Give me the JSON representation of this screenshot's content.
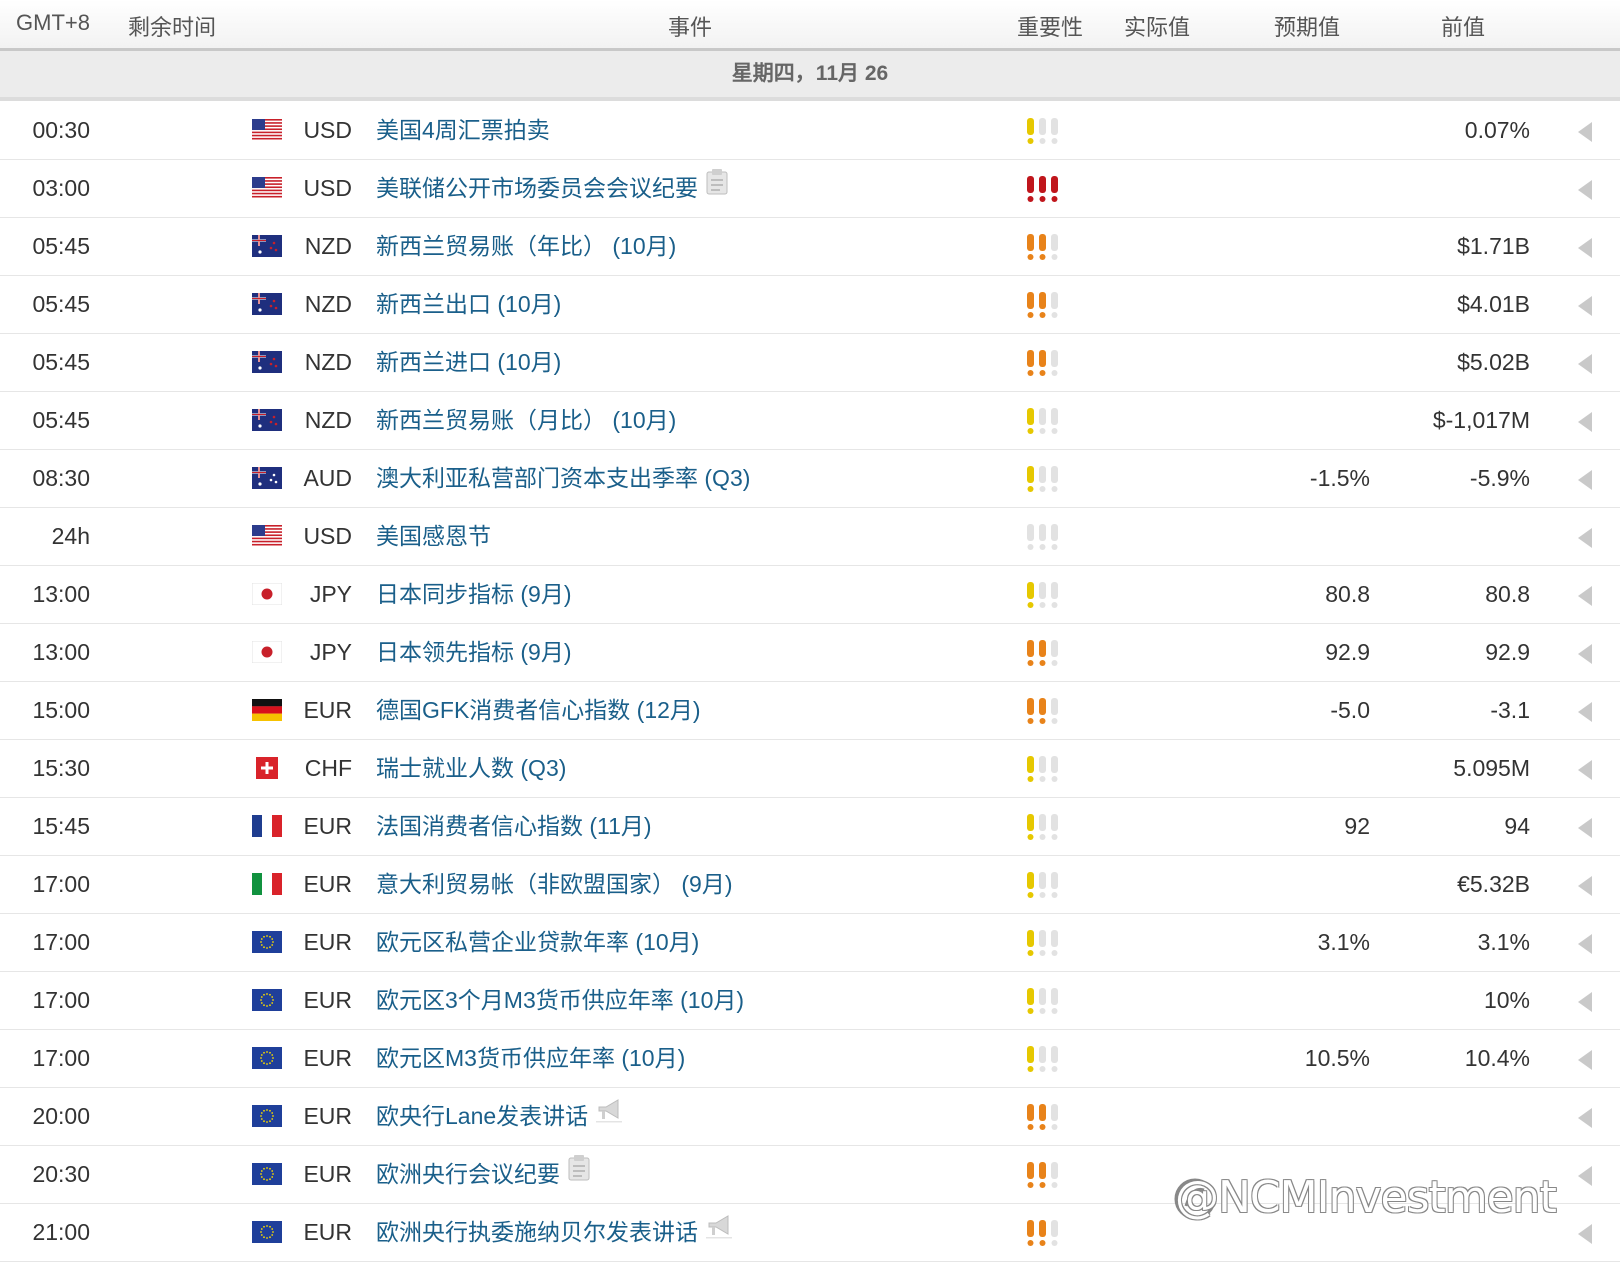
{
  "header": {
    "timezone": "GMT+8",
    "remaining": "剩余时间",
    "event": "事件",
    "importance": "重要性",
    "actual": "实际值",
    "forecast": "预期值",
    "previous": "前值"
  },
  "date_label": "星期四，11月 26",
  "colors": {
    "event_link": "#1a5f8a",
    "importance_low": "#e6c800",
    "importance_medium": "#e8831a",
    "importance_high": "#c0161c",
    "importance_empty": "#e2e2e2"
  },
  "events": [
    {
      "time": "00:30",
      "flag": "us",
      "currency": "USD",
      "name": "美国4周汇票拍卖",
      "icon": "",
      "importance": 1,
      "actual": "",
      "forecast": "",
      "previous": "0.07%"
    },
    {
      "time": "03:00",
      "flag": "us",
      "currency": "USD",
      "name": "美联储公开市场委员会会议纪要",
      "icon": "document-icon",
      "importance": 3,
      "actual": "",
      "forecast": "",
      "previous": ""
    },
    {
      "time": "05:45",
      "flag": "nz",
      "currency": "NZD",
      "name": "新西兰贸易账（年比） (10月)",
      "icon": "",
      "importance": 2,
      "actual": "",
      "forecast": "",
      "previous": "$1.71B"
    },
    {
      "time": "05:45",
      "flag": "nz",
      "currency": "NZD",
      "name": "新西兰出口 (10月)",
      "icon": "",
      "importance": 2,
      "actual": "",
      "forecast": "",
      "previous": "$4.01B"
    },
    {
      "time": "05:45",
      "flag": "nz",
      "currency": "NZD",
      "name": "新西兰进口 (10月)",
      "icon": "",
      "importance": 2,
      "actual": "",
      "forecast": "",
      "previous": "$5.02B"
    },
    {
      "time": "05:45",
      "flag": "nz",
      "currency": "NZD",
      "name": "新西兰贸易账（月比） (10月)",
      "icon": "",
      "importance": 1,
      "actual": "",
      "forecast": "",
      "previous": "$-1,017M"
    },
    {
      "time": "08:30",
      "flag": "au",
      "currency": "AUD",
      "name": "澳大利亚私营部门资本支出季率 (Q3)",
      "icon": "",
      "importance": 1,
      "actual": "",
      "forecast": "-1.5%",
      "previous": "-5.9%"
    },
    {
      "time": "24h",
      "flag": "us",
      "currency": "USD",
      "name": "美国感恩节",
      "icon": "",
      "importance": 0,
      "actual": "",
      "forecast": "",
      "previous": ""
    },
    {
      "time": "13:00",
      "flag": "jp",
      "currency": "JPY",
      "name": "日本同步指标 (9月)",
      "icon": "",
      "importance": 1,
      "actual": "",
      "forecast": "80.8",
      "previous": "80.8"
    },
    {
      "time": "13:00",
      "flag": "jp",
      "currency": "JPY",
      "name": "日本领先指标 (9月)",
      "icon": "",
      "importance": 2,
      "actual": "",
      "forecast": "92.9",
      "previous": "92.9"
    },
    {
      "time": "15:00",
      "flag": "de",
      "currency": "EUR",
      "name": "德国GFK消费者信心指数 (12月)",
      "icon": "",
      "importance": 2,
      "actual": "",
      "forecast": "-5.0",
      "previous": "-3.1"
    },
    {
      "time": "15:30",
      "flag": "ch",
      "currency": "CHF",
      "name": "瑞士就业人数 (Q3)",
      "icon": "",
      "importance": 1,
      "actual": "",
      "forecast": "",
      "previous": "5.095M"
    },
    {
      "time": "15:45",
      "flag": "fr",
      "currency": "EUR",
      "name": "法国消费者信心指数 (11月)",
      "icon": "",
      "importance": 1,
      "actual": "",
      "forecast": "92",
      "previous": "94"
    },
    {
      "time": "17:00",
      "flag": "it",
      "currency": "EUR",
      "name": "意大利贸易帐（非欧盟国家） (9月)",
      "icon": "",
      "importance": 1,
      "actual": "",
      "forecast": "",
      "previous": "€5.32B"
    },
    {
      "time": "17:00",
      "flag": "eu",
      "currency": "EUR",
      "name": "欧元区私营企业贷款年率 (10月)",
      "icon": "",
      "importance": 1,
      "actual": "",
      "forecast": "3.1%",
      "previous": "3.1%"
    },
    {
      "time": "17:00",
      "flag": "eu",
      "currency": "EUR",
      "name": "欧元区3个月M3货币供应年率 (10月)",
      "icon": "",
      "importance": 1,
      "actual": "",
      "forecast": "",
      "previous": "10%"
    },
    {
      "time": "17:00",
      "flag": "eu",
      "currency": "EUR",
      "name": "欧元区M3货币供应年率 (10月)",
      "icon": "",
      "importance": 1,
      "actual": "",
      "forecast": "10.5%",
      "previous": "10.4%"
    },
    {
      "time": "20:00",
      "flag": "eu",
      "currency": "EUR",
      "name": "欧央行Lane发表讲话",
      "icon": "megaphone-icon",
      "importance": 2,
      "actual": "",
      "forecast": "",
      "previous": ""
    },
    {
      "time": "20:30",
      "flag": "eu",
      "currency": "EUR",
      "name": "欧洲央行会议纪要",
      "icon": "document-icon",
      "importance": 2,
      "actual": "",
      "forecast": "",
      "previous": ""
    },
    {
      "time": "21:00",
      "flag": "eu",
      "currency": "EUR",
      "name": "欧洲央行执委施纳贝尔发表讲话",
      "icon": "megaphone-icon",
      "importance": 2,
      "actual": "",
      "forecast": "",
      "previous": ""
    }
  ],
  "watermark": "@NCMInvestment"
}
